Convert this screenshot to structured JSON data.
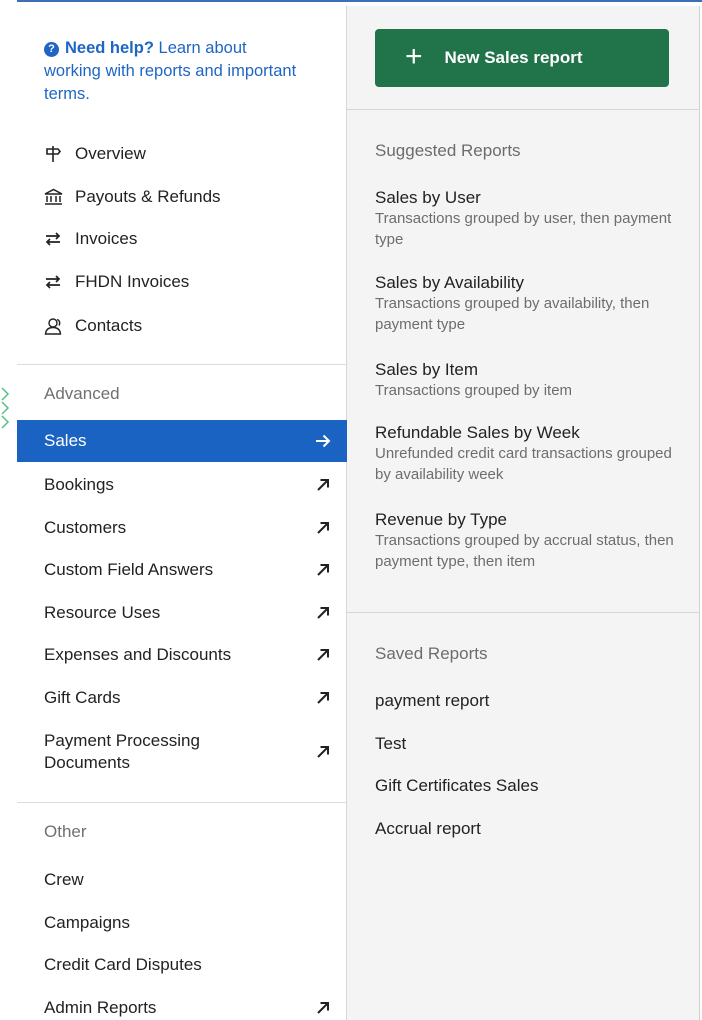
{
  "help": {
    "strong": "Need help?",
    "rest": " Learn about working with reports and important terms."
  },
  "nav": [
    {
      "label": "Overview",
      "icon": "signpost-icon"
    },
    {
      "label": "Payouts & Refunds",
      "icon": "bank-icon"
    },
    {
      "label": "Invoices",
      "icon": "swap-arrows-icon"
    },
    {
      "label": "FHDN Invoices",
      "icon": "swap-arrows-icon"
    },
    {
      "label": "Contacts",
      "icon": "contacts-icon"
    }
  ],
  "advanced": {
    "heading": "Advanced",
    "items": [
      {
        "label": "Sales",
        "active": true
      },
      {
        "label": "Bookings"
      },
      {
        "label": "Customers"
      },
      {
        "label": "Custom Field Answers"
      },
      {
        "label": "Resource Uses"
      },
      {
        "label": "Expenses and Discounts"
      },
      {
        "label": "Gift Cards"
      },
      {
        "label": "Payment Processing Documents"
      }
    ]
  },
  "other": {
    "heading": "Other",
    "items": [
      {
        "label": "Crew"
      },
      {
        "label": "Campaigns"
      },
      {
        "label": "Credit Card Disputes"
      },
      {
        "label": "Admin Reports"
      }
    ]
  },
  "right": {
    "new_button": "New Sales report",
    "suggested_heading": "Suggested Reports",
    "suggested": [
      {
        "title": "Sales by User",
        "desc": "Transactions grouped by user, then payment type"
      },
      {
        "title": "Sales by Availability",
        "desc": "Transactions grouped by availability, then payment type"
      },
      {
        "title": "Sales by Item",
        "desc": "Transactions grouped by item"
      },
      {
        "title": "Refundable Sales by Week",
        "desc": "Unrefunded credit card transactions grouped by availability week"
      },
      {
        "title": "Revenue by Type",
        "desc": "Transactions grouped by accrual status, then payment type, then item"
      }
    ],
    "saved_heading": "Saved Reports",
    "saved": [
      "payment report",
      "Test",
      "Gift Certificates Sales",
      "Accrual report"
    ]
  },
  "colors": {
    "accent": "#1a63c2",
    "link": "#1f66c4",
    "button": "#21744a"
  }
}
